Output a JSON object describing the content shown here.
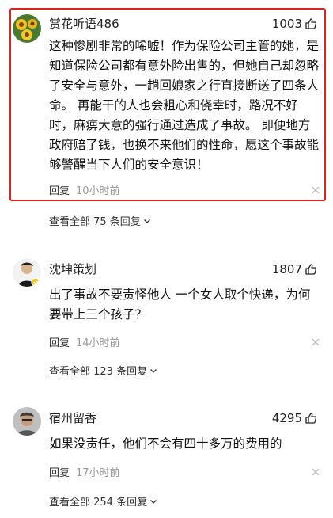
{
  "comments": [
    {
      "username": "赏花听语486",
      "likes": "1003",
      "content": "这种惨剧非常的唏嘘！作为保险公司主管的她，是知道保险公司都有意外险出售的，但她自己却忽略了安全与意外，一趟回娘家之行直接断送了四条人命。 再能干的人也会粗心和侥幸时，路况不好时，麻痹大意的强行通过造成了事故。 即便地方政府赔了钱，也换不来他们的性命，愿这个事故能够警醒当下人们的安全意识！",
      "reply_label": "回复",
      "time": "10小时前",
      "view_replies": "查看全部 75 条回复"
    },
    {
      "username": "沈坤策划",
      "likes": "1807",
      "content": "出了事故不要责怪他人 一个女人取个快递，为何要带上三个孩子？",
      "reply_label": "回复",
      "time": "14小时前",
      "view_replies": "查看全部 123 条回复"
    },
    {
      "username": "宿州留香",
      "likes": "4295",
      "content": "如果没责任，他们不会有四十多万的费用的",
      "reply_label": "回复",
      "time": "17小时前",
      "view_replies": "查看全部 254 条回复"
    }
  ],
  "colors": {
    "highlight_border": "#e02020",
    "muted": "#999999",
    "text": "#222222"
  }
}
